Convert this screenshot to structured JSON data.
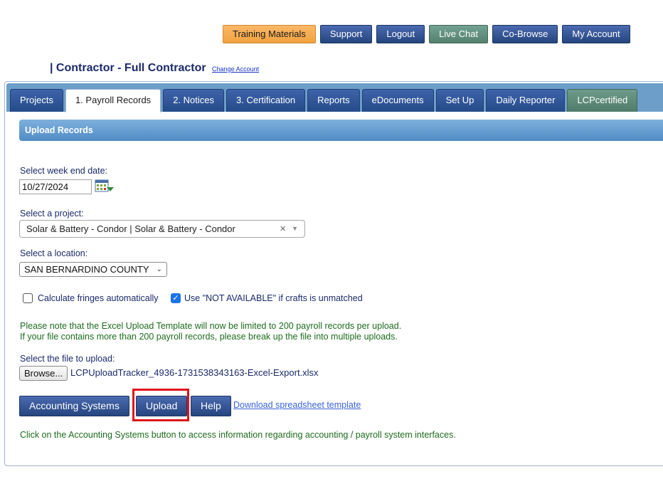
{
  "top_nav": {
    "training": "Training Materials",
    "support": "Support",
    "logout": "Logout",
    "live_chat": "Live Chat",
    "co_browse": "Co-Browse",
    "my_account": "My Account"
  },
  "account": {
    "title": "| Contractor - Full Contractor",
    "change_link": "Change Account"
  },
  "tabs": {
    "projects": "Projects",
    "payroll": "1. Payroll Records",
    "notices": "2. Notices",
    "certification": "3. Certification",
    "reports": "Reports",
    "edocuments": "eDocuments",
    "setup": "Set Up",
    "daily_reporter": "Daily Reporter",
    "lcpcertified": "LCPcertified"
  },
  "section": {
    "title": "Upload Records"
  },
  "form": {
    "week_end_label": "Select week end date:",
    "week_end_value": "10/27/2024",
    "project_label": "Select a project:",
    "project_value": "Solar & Battery - Condor | Solar & Battery - Condor",
    "project_clear": "×",
    "project_arrow": "▼",
    "location_label": "Select a location:",
    "location_value": "SAN BERNARDINO COUNTY",
    "location_chevron": "⌄",
    "calc_fringes_label": "Calculate fringes automatically",
    "calc_fringes_checked": false,
    "not_available_label": "Use \"NOT AVAILABLE\" if crafts is unmatched",
    "not_available_checked": true,
    "check_mark": "✓",
    "file_label": "Select the file to upload:",
    "browse_label": "Browse...",
    "file_name": "LCPUploadTracker_4936-1731538343163-Excel-Export.xlsx"
  },
  "notices": {
    "line1": "Please note that the Excel Upload Template will now be limited to 200 payroll records per upload.",
    "line2": "If your file contains more than 200 payroll records, please break up the file into multiple uploads."
  },
  "actions": {
    "accounting": "Accounting Systems",
    "upload": "Upload",
    "help": "Help",
    "download_link": "Download spreadsheet template"
  },
  "footer_note": "Click on the Accounting Systems button to access information regarding accounting / payroll system interfaces.",
  "colors": {
    "nav_blue": "#25457f",
    "training_orange": "#f2a23f",
    "chat_green": "#55806f",
    "notice_green": "#1e6b1e",
    "highlight_red": "#e0141b"
  }
}
